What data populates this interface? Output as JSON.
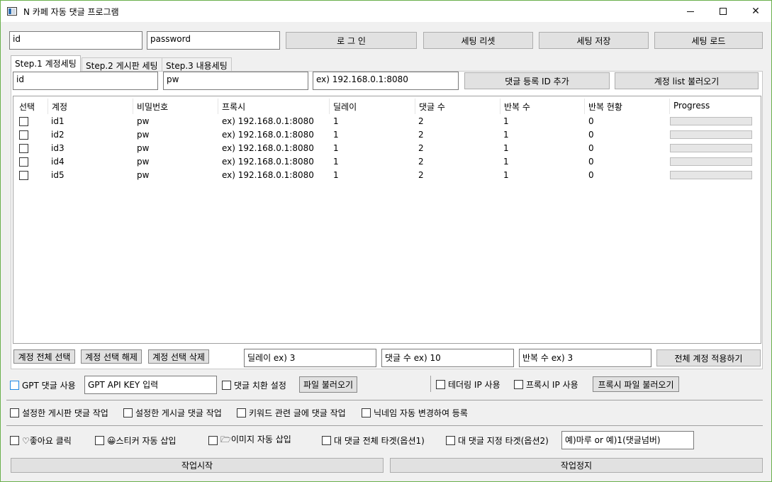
{
  "window": {
    "title": "N 카페 자동 댓글 프로그램"
  },
  "login": {
    "id_value": "id",
    "password_value": "password",
    "login_button": "로 그 인",
    "reset_button": "세팅 리셋",
    "save_button": "세팅 저장",
    "load_button": "세팅 로드"
  },
  "tabs": [
    "Step.1 계정세팅",
    "Step.2 게시판 세팅",
    "Step.3 내용세팅"
  ],
  "account": {
    "id_value": "id",
    "pw_value": "pw",
    "proxy_value": "ex) 192.168.0.1:8080",
    "add_button": "댓글 등록 ID 추가",
    "load_list_button": "계정 list 불러오기"
  },
  "table": {
    "headers": [
      "선택",
      "계정",
      "비밀번호",
      "프록시",
      "딜레이",
      "댓글 수",
      "반복 수",
      "반복 현황",
      "Progress"
    ],
    "rows": [
      {
        "account": "id1",
        "pw": "pw",
        "proxy": "ex) 192.168.0.1:8080",
        "delay": "1",
        "comments": "2",
        "repeat": "1",
        "status": "0",
        "progress": 0
      },
      {
        "account": "id2",
        "pw": "pw",
        "proxy": "ex) 192.168.0.1:8080",
        "delay": "1",
        "comments": "2",
        "repeat": "1",
        "status": "0",
        "progress": 0
      },
      {
        "account": "id3",
        "pw": "pw",
        "proxy": "ex) 192.168.0.1:8080",
        "delay": "1",
        "comments": "2",
        "repeat": "1",
        "status": "0",
        "progress": 0
      },
      {
        "account": "id4",
        "pw": "pw",
        "proxy": "ex) 192.168.0.1:8080",
        "delay": "1",
        "comments": "2",
        "repeat": "1",
        "status": "0",
        "progress": 0
      },
      {
        "account": "id5",
        "pw": "pw",
        "proxy": "ex) 192.168.0.1:8080",
        "delay": "1",
        "comments": "2",
        "repeat": "1",
        "status": "0",
        "progress": 0
      }
    ]
  },
  "bulk": {
    "select_all": "계정 전체 선택",
    "deselect": "계정 선택 해제",
    "delete_selected": "계정 선택 삭제",
    "delay_value": "딜레이 ex) 3",
    "comments_value": "댓글 수 ex) 10",
    "repeat_value": "반복 수 ex) 3",
    "apply_all": "전체 계정 적용하기"
  },
  "options": {
    "gpt_label": "GPT 댓글 사용",
    "gpt_key_value": "GPT API KEY 입력",
    "replace_label": "댓글 치환 설정",
    "file_load_button": "파일 불러오기",
    "tethering_label": "테더링 IP 사용",
    "proxy_ip_label": "프록시 IP 사용",
    "proxy_file_button": "프록시 파일 불러오기",
    "board_comment_label": "설정한 게시판 댓글 작업",
    "post_comment_label": "설정한 게시글 댓글 작업",
    "keyword_label": "키워드 관련 글에 댓글 작업",
    "nickname_label": "닉네임 자동 변경하여 등록",
    "like_label": "♡좋아요 클릭",
    "sticker_label": "😀스티커 자동 삽입",
    "image_label": "🗁이미지 자동 삽입",
    "reply_all_label": "대 댓글 전체 타겟(옵션1)",
    "reply_target_label": "대 댓글 지정 타겟(옵션2)",
    "reply_target_value": "예)마루 or 예)1(댓글넘버)"
  },
  "actions": {
    "start": "작업시작",
    "stop": "작업정지"
  },
  "colors": {
    "window_border": "#6ab04c",
    "progress_fill": "#06b025",
    "gpt_checkbox": "#1e88e5"
  }
}
